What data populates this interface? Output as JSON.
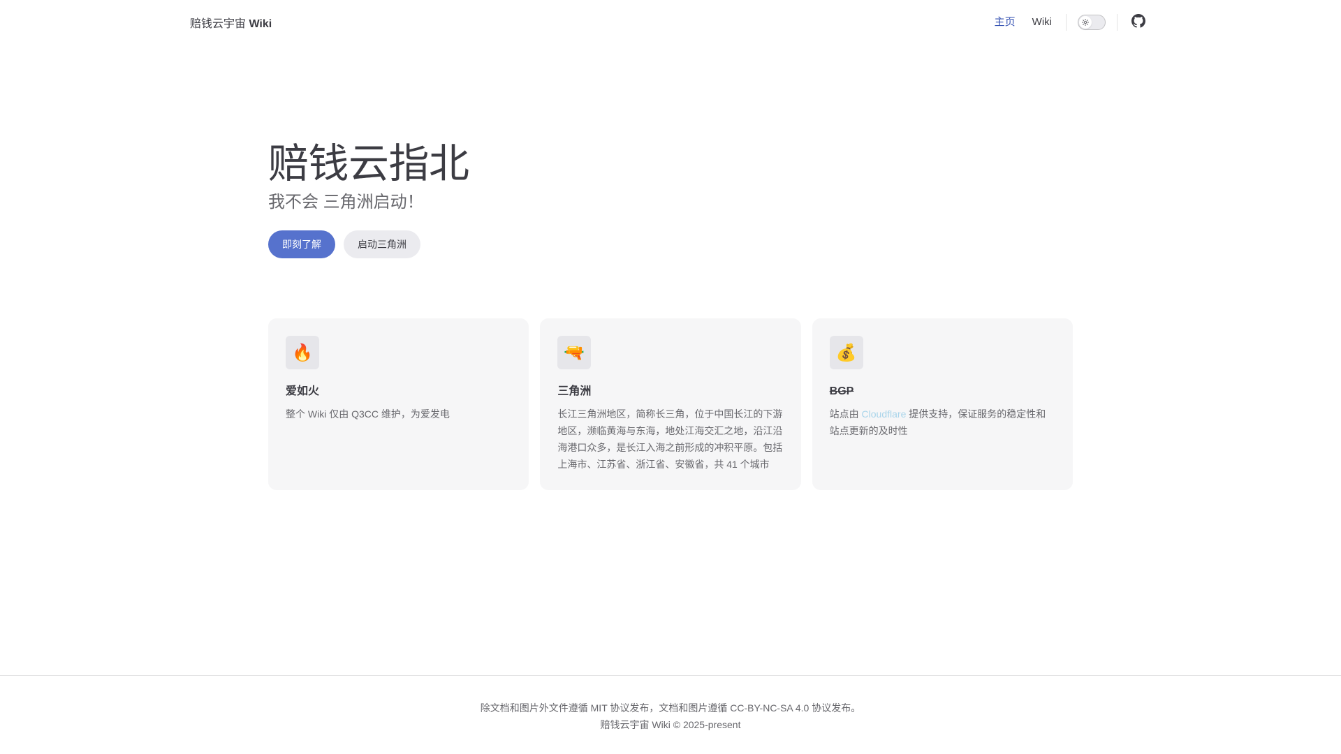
{
  "nav": {
    "title_prefix": "赔钱云宇宙",
    "title_suffix": "Wiki",
    "links": [
      {
        "label": "主页",
        "active": true
      },
      {
        "label": "Wiki",
        "active": false
      }
    ],
    "theme_toggle_icon": "sun-icon",
    "github_icon": "github-icon"
  },
  "hero": {
    "name": "赔钱云指北",
    "tagline": "我不会 三角洲启动！",
    "actions": [
      {
        "label": "即刻了解",
        "theme": "brand"
      },
      {
        "label": "启动三角洲",
        "theme": "alt"
      }
    ]
  },
  "features": [
    {
      "icon": "🔥",
      "icon_name": "fire-icon",
      "title": "爱如火",
      "details": "整个 Wiki 仅由 Q3CC 维护，为爱发电"
    },
    {
      "icon": "🔫",
      "icon_name": "water-gun-icon",
      "title": "三角洲",
      "details": "长江三角洲地区，简称长三角，位于中国长江的下游地区，濒临黄海与东海，地处江海交汇之地，沿江沿海港口众多，是长江入海之前形成的冲积平原。包括上海市、江苏省、浙江省、安徽省，共 41 个城市"
    },
    {
      "icon": "💰",
      "icon_name": "money-bag-icon",
      "title": "BGP",
      "details_prefix": "站点由 ",
      "details_link": "Cloudflare",
      "details_suffix": " 提供支持，保证服务的稳定性和站点更新的及时性"
    }
  ],
  "footer": {
    "message": "除文档和图片外文件遵循 MIT 协议发布，文档和图片遵循 CC-BY-NC-SA 4.0 协议发布。",
    "copyright": "赔钱云宇宙 Wiki © 2025-present"
  },
  "colors": {
    "brand": "#5672cd",
    "nav_active": "#3451b2",
    "link_light": "#a8d4ea",
    "feature_bg": "#f6f6f7"
  }
}
